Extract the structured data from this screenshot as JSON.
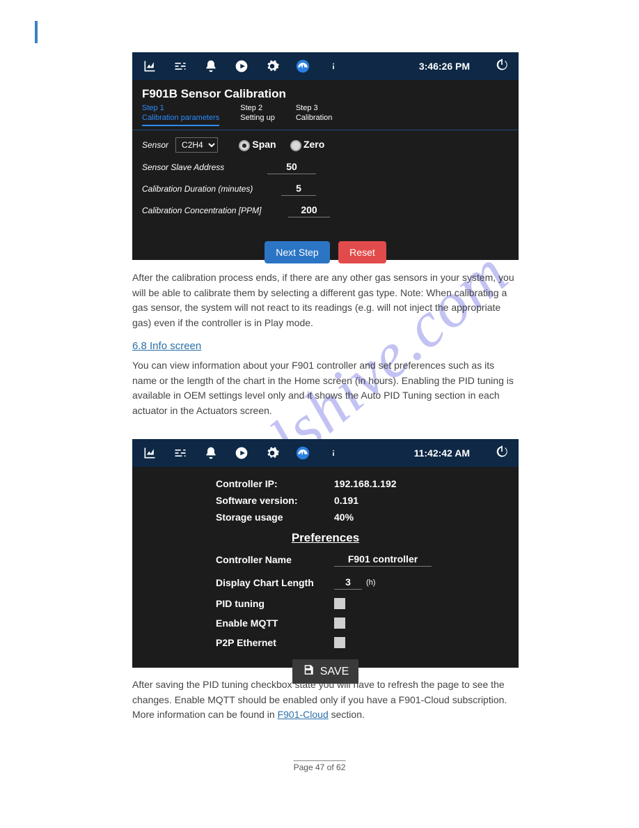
{
  "watermark": "manualshive.com",
  "footer": {
    "page": "Page 47 of 62"
  },
  "window1": {
    "clock": "3:46:26 PM",
    "title": "F901B Sensor Calibration",
    "steps": [
      {
        "name": "Step 1",
        "sub": "Calibration parameters"
      },
      {
        "name": "Step 2",
        "sub": "Setting up"
      },
      {
        "name": "Step 3",
        "sub": "Calibration"
      }
    ],
    "sensor_label": "Sensor",
    "sensor_value": "C2H4",
    "radio_span": "Span",
    "radio_zero": "Zero",
    "slave_label": "Sensor Slave Address",
    "slave_value": "50",
    "duration_label": "Calibration Duration (minutes)",
    "duration_value": "5",
    "conc_label": "Calibration Concentration [PPM]",
    "conc_value": "200",
    "next_btn": "Next Step",
    "reset_btn": "Reset"
  },
  "doc1": {
    "p1": "After the calibration process ends, if there are any other gas sensors in your system, you will be able to calibrate them by selecting a different gas type. Note: When calibrating a gas sensor, the system will not react to its readings (e.g. will not inject the appropriate gas) even if the controller is in Play mode.",
    "heading": "6.8 Info screen",
    "p2": "You can view information about your F901 controller and set preferences such as its name or the length of the chart in the Home screen (in hours). Enabling the PID tuning is available in OEM settings level only and it shows the Auto PID Tuning section in each actuator in the Actuators screen."
  },
  "window2": {
    "clock": "11:42:42 AM",
    "info": {
      "ip_label": "Controller IP:",
      "ip_value": "192.168.1.192",
      "ver_label": "Software version:",
      "ver_value": "0.191",
      "storage_label": "Storage usage",
      "storage_value": "40%"
    },
    "pref_title": "Preferences",
    "pref": {
      "name_label": "Controller Name",
      "name_value": "F901 controller",
      "length_label": "Display Chart Length",
      "length_value": "3",
      "length_unit": "(h)",
      "pid_label": "PID tuning",
      "mqtt_label": "Enable MQTT",
      "p2p_label": "P2P Ethernet"
    },
    "save_btn": "SAVE"
  },
  "doc2": {
    "p1_a": "After saving the PID tuning checkbox state you will have to refresh the page to see the changes.",
    "p1_b": "Enable MQTT should be enabled only if you have a F901-Cloud subscription. More information can be found in ",
    "link": "F901-Cloud",
    "p1_c": " section."
  }
}
